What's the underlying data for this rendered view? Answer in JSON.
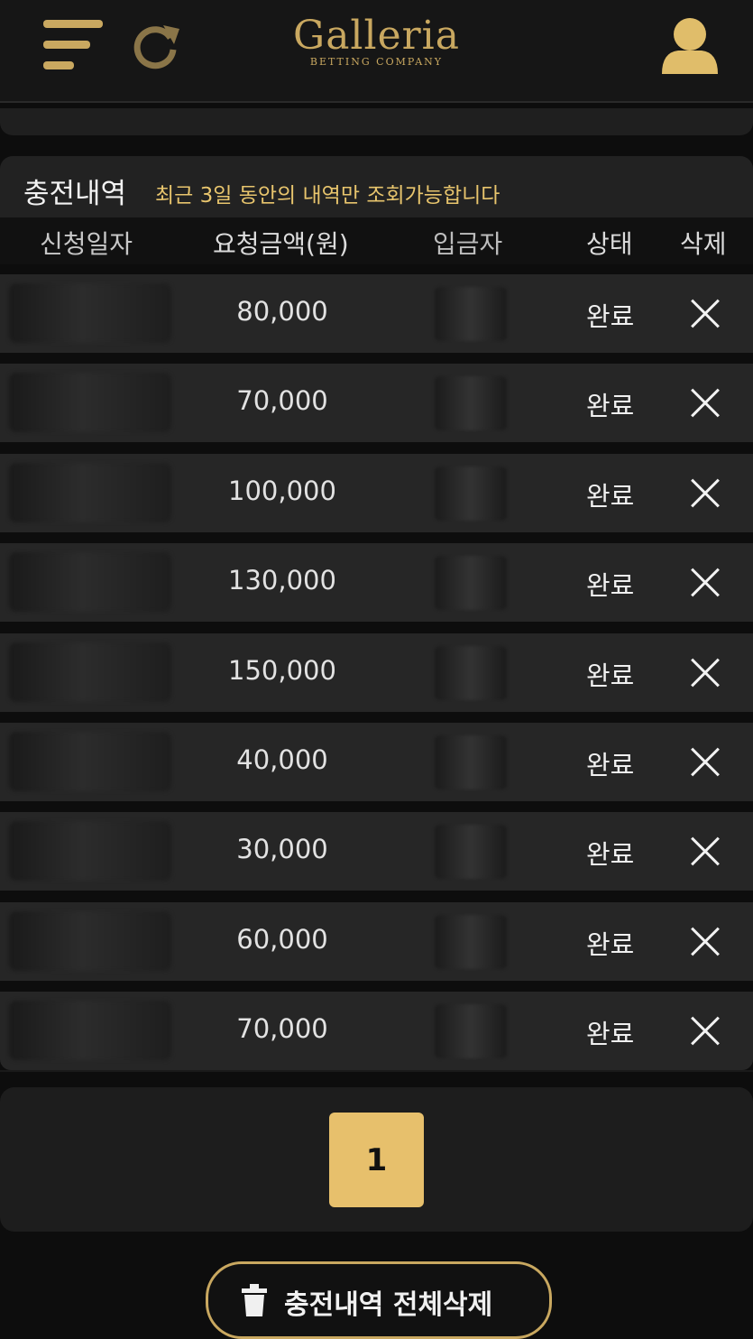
{
  "header": {
    "logo_title": "Galleria",
    "logo_subtitle": "BETTING COMPANY",
    "menu_icon": "hamburger-icon",
    "refresh_icon": "refresh-icon",
    "user_icon": "user-icon",
    "accent_color": "#c9a860"
  },
  "panel": {
    "title": "충전내역",
    "note": "최근 3일 동안의 내역만 조회가능합니다"
  },
  "columns": {
    "date": "신청일자",
    "amount": "요청금액(원)",
    "depositor": "입금자",
    "status": "상태",
    "delete": "삭제"
  },
  "rows": [
    {
      "amount": "80,000",
      "status": "완료"
    },
    {
      "amount": "70,000",
      "status": "완료"
    },
    {
      "amount": "100,000",
      "status": "완료"
    },
    {
      "amount": "130,000",
      "status": "완료"
    },
    {
      "amount": "150,000",
      "status": "완료"
    },
    {
      "amount": "40,000",
      "status": "완료"
    },
    {
      "amount": "30,000",
      "status": "완료"
    },
    {
      "amount": "60,000",
      "status": "완료"
    },
    {
      "amount": "70,000",
      "status": "완료"
    }
  ],
  "pagination": {
    "current_page": "1",
    "highlight_color": "#e7c06c"
  },
  "footer": {
    "delete_all_label": "충전내역 전체삭제",
    "delete_all_icon": "trash-icon"
  }
}
